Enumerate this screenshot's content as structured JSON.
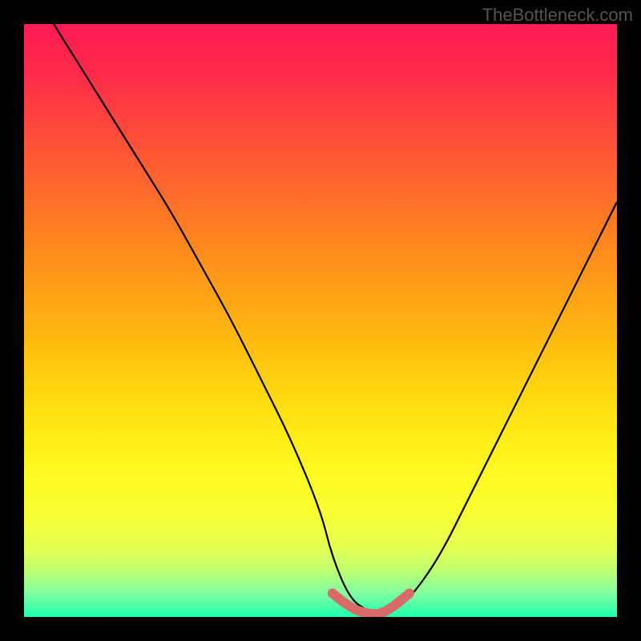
{
  "watermark": "TheBottleneck.com",
  "chart_data": {
    "type": "line",
    "title": "",
    "xlabel": "",
    "ylabel": "",
    "xlim": [
      0,
      100
    ],
    "ylim": [
      0,
      100
    ],
    "series": [
      {
        "name": "bottleneck-curve",
        "x": [
          5,
          10,
          15,
          20,
          25,
          30,
          35,
          40,
          45,
          50,
          52,
          55,
          58,
          60,
          62,
          65,
          70,
          75,
          80,
          85,
          90,
          95,
          100
        ],
        "values": [
          100,
          92,
          84,
          76,
          68,
          59,
          50,
          40,
          30,
          18,
          10,
          3,
          1,
          0,
          1,
          3,
          10,
          20,
          30,
          40,
          50,
          60,
          70
        ]
      }
    ],
    "highlight": {
      "name": "optimal-range",
      "x": [
        52,
        55,
        58,
        60,
        62,
        65
      ],
      "values": [
        4,
        1.5,
        0.5,
        0.5,
        1.5,
        4
      ],
      "color": "#d86a6a"
    },
    "background_gradient": {
      "top": "#ff1a55",
      "mid": "#ffd000",
      "bottom": "#20ffb0"
    }
  }
}
